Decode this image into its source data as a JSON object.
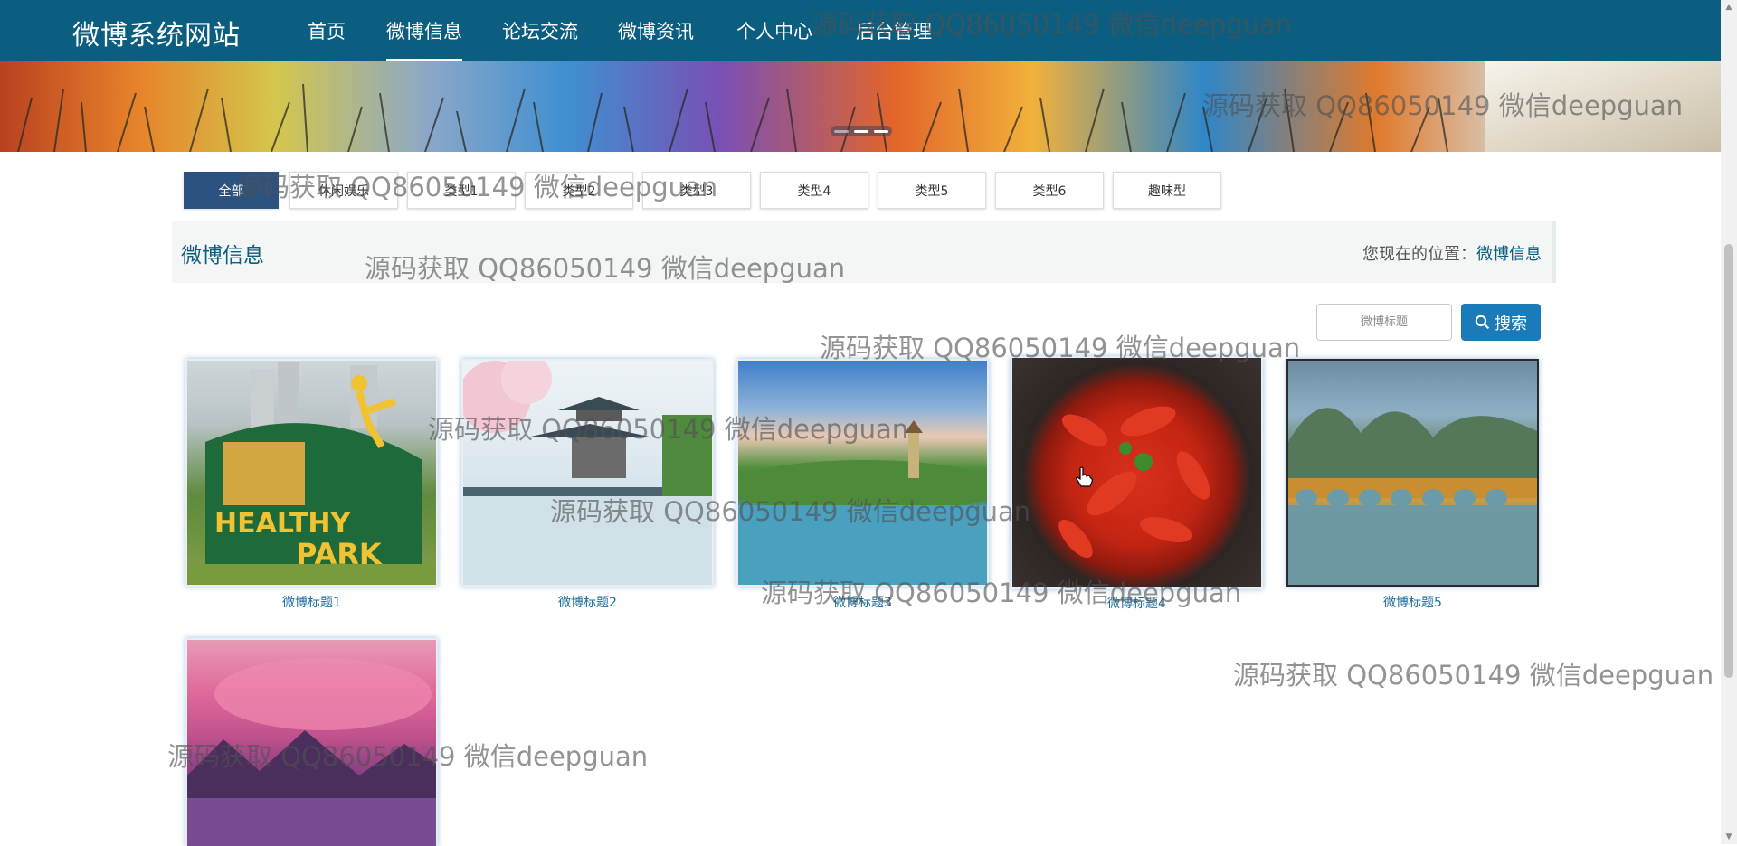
{
  "site": {
    "brand": "微博系统网站"
  },
  "nav": {
    "items": [
      {
        "label": "首页",
        "active": false
      },
      {
        "label": "微博信息",
        "active": true
      },
      {
        "label": "论坛交流",
        "active": false
      },
      {
        "label": "微博资讯",
        "active": false
      },
      {
        "label": "个人中心",
        "active": false
      },
      {
        "label": "后台管理",
        "active": false
      }
    ]
  },
  "banner": {
    "active_slide": 1,
    "slide_count": 3
  },
  "categories": [
    "全部",
    "休闲娱乐",
    "类型1",
    "类型2",
    "类型3",
    "类型4",
    "类型5",
    "类型6",
    "趣味型"
  ],
  "active_category": "全部",
  "section": {
    "title": "微博信息",
    "crumb_prefix": "您现在的位置：",
    "crumb_current": "微博信息"
  },
  "search": {
    "placeholder": "微博标题",
    "value": "",
    "button_label": "搜索"
  },
  "cards": [
    {
      "title": "微博标题1"
    },
    {
      "title": "微博标题2"
    },
    {
      "title": "微博标题3"
    },
    {
      "title": "微博标题4"
    },
    {
      "title": "微博标题5"
    },
    {
      "title": ""
    }
  ],
  "watermark": "源码获取 QQ86050149 微信deepguan",
  "colors": {
    "nav_bg": "#0b5e7f",
    "active_tab": "#2c5380",
    "search_button": "#1b7bb8",
    "card_title": "#1e6e9e"
  }
}
